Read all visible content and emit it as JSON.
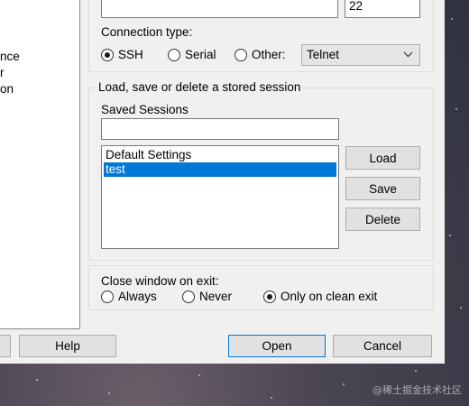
{
  "tree": {
    "items": [
      "nce",
      "r",
      "on"
    ]
  },
  "session": {
    "port_value": "22",
    "connection_type_label": "Connection type:",
    "connection_types": [
      {
        "label": "SSH",
        "checked": true
      },
      {
        "label": "Serial",
        "checked": false
      },
      {
        "label": "Other:",
        "checked": false
      }
    ],
    "other_protocol_selected": "Telnet"
  },
  "stored_session": {
    "group_title": "Load, save or delete a stored session",
    "saved_sessions_label": "Saved Sessions",
    "saved_sessions_value": "",
    "list": [
      {
        "label": "Default Settings",
        "selected": false
      },
      {
        "label": "test",
        "selected": true
      }
    ],
    "load_label": "Load",
    "save_label": "Save",
    "delete_label": "Delete"
  },
  "close_window": {
    "label": "Close window on exit:",
    "options": [
      {
        "label": "Always",
        "checked": false
      },
      {
        "label": "Never",
        "checked": false
      },
      {
        "label": "Only on clean exit",
        "checked": true
      }
    ]
  },
  "footer": {
    "help_label": "Help",
    "open_label": "Open",
    "cancel_label": "Cancel"
  },
  "watermark": "@稀土掘金技术社区",
  "colors": {
    "dialog_bg": "#f0f0f0",
    "selection": "#0078d7",
    "button_face": "#e1e1e1"
  }
}
